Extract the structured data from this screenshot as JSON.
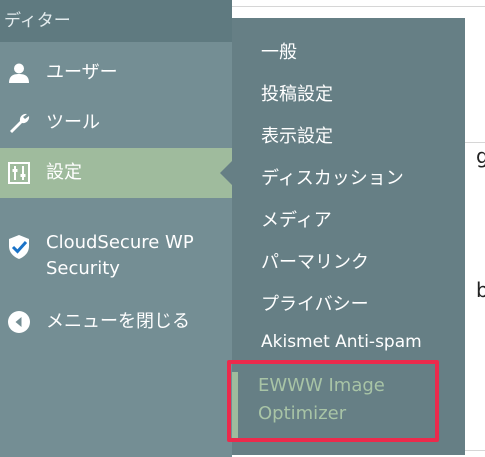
{
  "sidebar": {
    "top_label": "ディター",
    "items": [
      {
        "label": "ユーザー",
        "icon": "user-icon"
      },
      {
        "label": "ツール",
        "icon": "wrench-icon"
      },
      {
        "label": "設定",
        "icon": "settings-sliders-icon",
        "active": true
      },
      {
        "label_line1": "CloudSecure WP",
        "label_line2": "Security",
        "icon": "shield-check-icon"
      },
      {
        "label": "メニューを閉じる",
        "icon": "collapse-arrow-icon"
      }
    ]
  },
  "submenu": {
    "items": [
      {
        "label": "一般"
      },
      {
        "label": "投稿設定"
      },
      {
        "label": "表示設定"
      },
      {
        "label": "ディスカッション"
      },
      {
        "label": "メディア"
      },
      {
        "label": "パーマリンク"
      },
      {
        "label": "プライバシー"
      },
      {
        "label": "Akismet Anti-spam"
      },
      {
        "label_line1": "EWWW Image",
        "label_line2": "Optimizer",
        "current": true
      }
    ]
  },
  "background_fragments": [
    "g",
    "b"
  ],
  "colors": {
    "sidebar": "#748e94",
    "flyout": "#667f85",
    "active": "#9fbb9d",
    "highlight": "#ec2a4c"
  }
}
